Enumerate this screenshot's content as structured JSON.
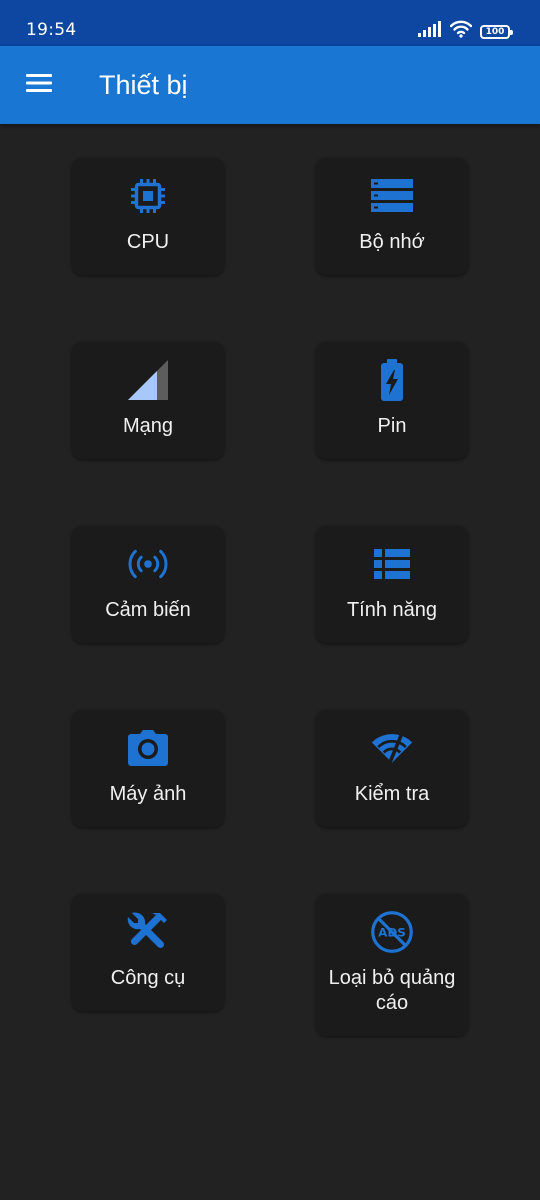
{
  "status_bar": {
    "time": "19:54",
    "battery": "100"
  },
  "app_bar": {
    "title": "Thiết bị"
  },
  "colors": {
    "accent": "#1976d2",
    "status_bar": "#0d47a1",
    "background": "#222222",
    "card": "#1b1b1b",
    "icon": "#1e73d2"
  },
  "tiles": [
    {
      "label": "CPU",
      "icon": "cpu-icon"
    },
    {
      "label": "Bộ nhớ",
      "icon": "storage-icon"
    },
    {
      "label": "Mạng",
      "icon": "signal-icon"
    },
    {
      "label": "Pin",
      "icon": "battery-charging-icon"
    },
    {
      "label": "Cảm biến",
      "icon": "sensor-icon"
    },
    {
      "label": "Tính năng",
      "icon": "list-icon"
    },
    {
      "label": "Máy ảnh",
      "icon": "camera-icon"
    },
    {
      "label": "Kiểm tra",
      "icon": "wifi-test-icon"
    },
    {
      "label": "Công cụ",
      "icon": "tools-icon"
    },
    {
      "label": "Loại bỏ quảng cáo",
      "icon": "no-ads-icon"
    }
  ]
}
